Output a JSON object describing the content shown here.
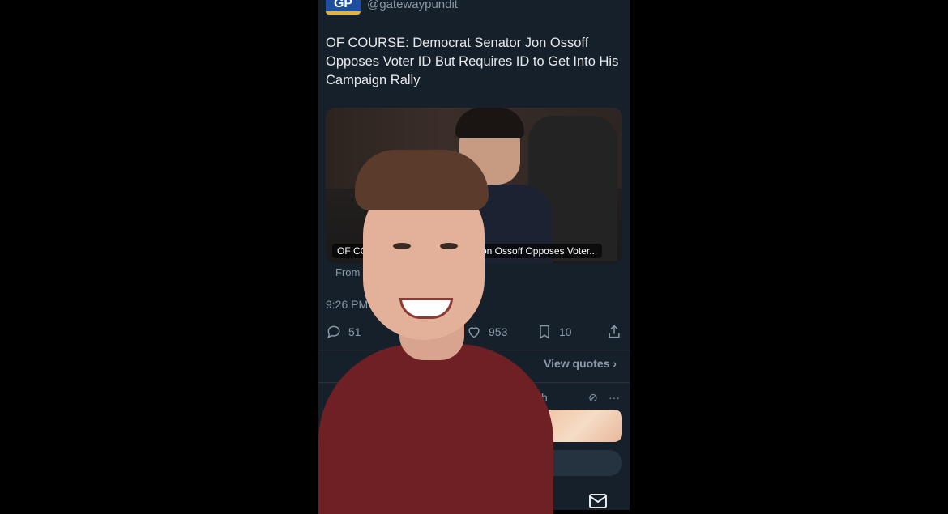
{
  "tweet": {
    "logo_text": "GP",
    "handle": "@gatewaypundit",
    "text": "OF COURSE: Democrat Senator Jon Ossoff Opposes Voter ID But Requires ID to Get Into His Campaign Rally",
    "media_caption_left": "OF CO",
    "media_caption_right": "on Ossoff Opposes Voter...",
    "from_label": "From",
    "timestamp": "9:26 PM ·",
    "replies": "51",
    "likes": "953",
    "bookmarks": "10",
    "view_quotes": "View quotes",
    "reply_row_time": "h",
    "reply_row_more": "···"
  },
  "colors": {
    "background": "#15202b",
    "text": "#e7e9ea",
    "muted": "#8b98a5",
    "shirt": "#6e2024"
  }
}
